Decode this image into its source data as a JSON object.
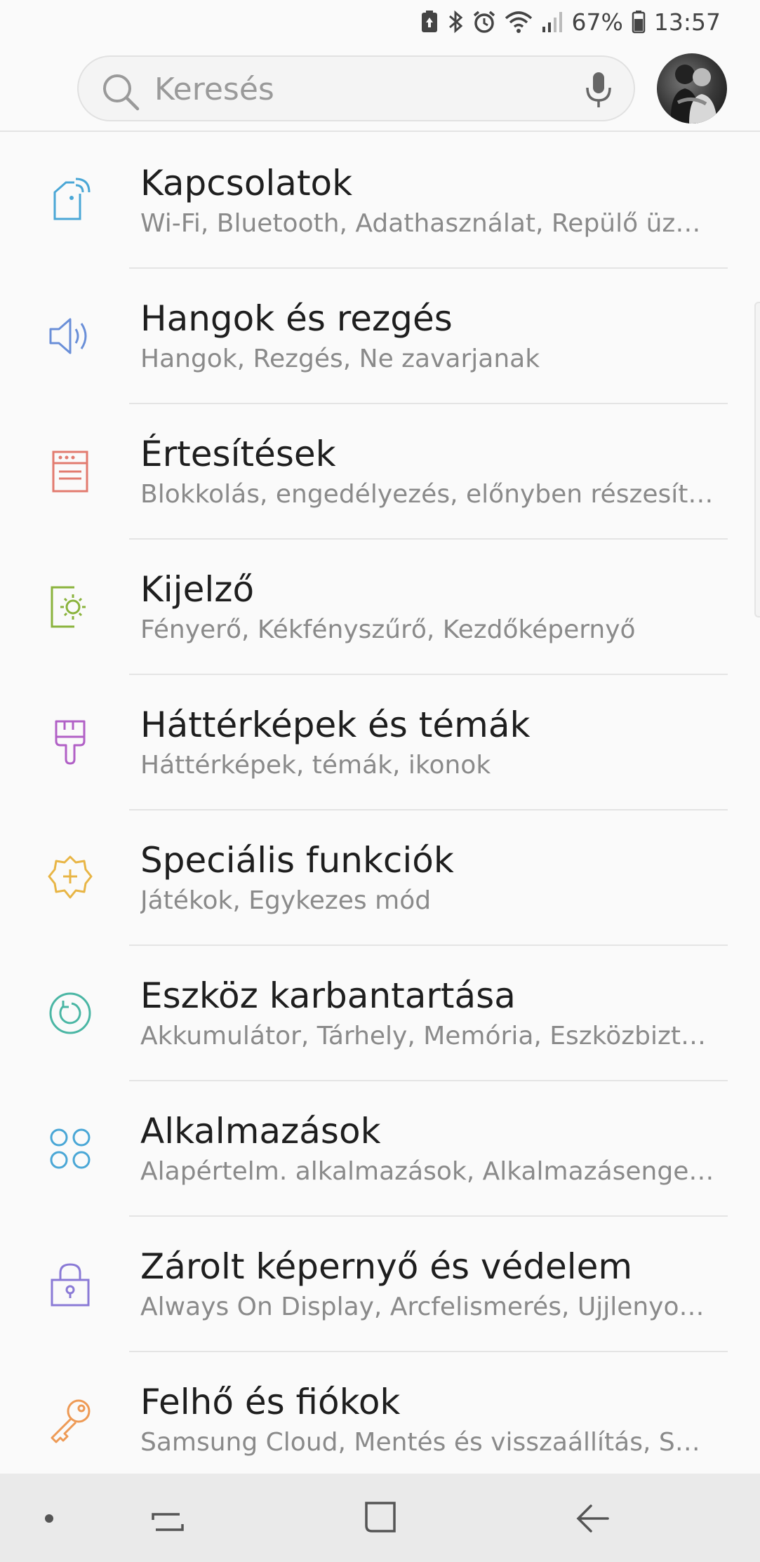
{
  "status_bar": {
    "battery": "67%",
    "time": "13:57"
  },
  "search": {
    "placeholder": "Keresés"
  },
  "colors": {
    "connections": "#4aa7d6",
    "sounds": "#6a8fd8",
    "notifications": "#e27b6f",
    "display": "#8ab33c",
    "wallpapers": "#b160c6",
    "advanced": "#e8b545",
    "maintenance": "#4ab6a4",
    "apps": "#4aa7d6",
    "lock": "#8a7ad6",
    "cloud": "#ee9a55"
  },
  "settings": [
    {
      "title": "Kapcsolatok",
      "subtitle": "Wi-Fi, Bluetooth, Adathasználat, Repülő üzem..."
    },
    {
      "title": "Hangok és rezgés",
      "subtitle": "Hangok, Rezgés, Ne zavarjanak"
    },
    {
      "title": "Értesítések",
      "subtitle": "Blokkolás, engedélyezés, előnyben részesítés"
    },
    {
      "title": "Kijelző",
      "subtitle": "Fényerő, Kékfényszűrő, Kezdőképernyő"
    },
    {
      "title": "Háttérképek és témák",
      "subtitle": "Háttérképek, témák, ikonok"
    },
    {
      "title": "Speciális funkciók",
      "subtitle": "Játékok, Egykezes mód"
    },
    {
      "title": "Eszköz karbantartása",
      "subtitle": "Akkumulátor, Tárhely, Memória, Eszközbiztons..."
    },
    {
      "title": "Alkalmazások",
      "subtitle": "Alapértelm. alkalmazások, Alkalmazásenged..."
    },
    {
      "title": "Zárolt képernyő és védelem",
      "subtitle": "Always On Display, Arcfelismerés, Ujjlenyomat..."
    },
    {
      "title": "Felhő és fiókok",
      "subtitle": "Samsung Cloud, Mentés és visszaállítás, Smar..."
    }
  ]
}
